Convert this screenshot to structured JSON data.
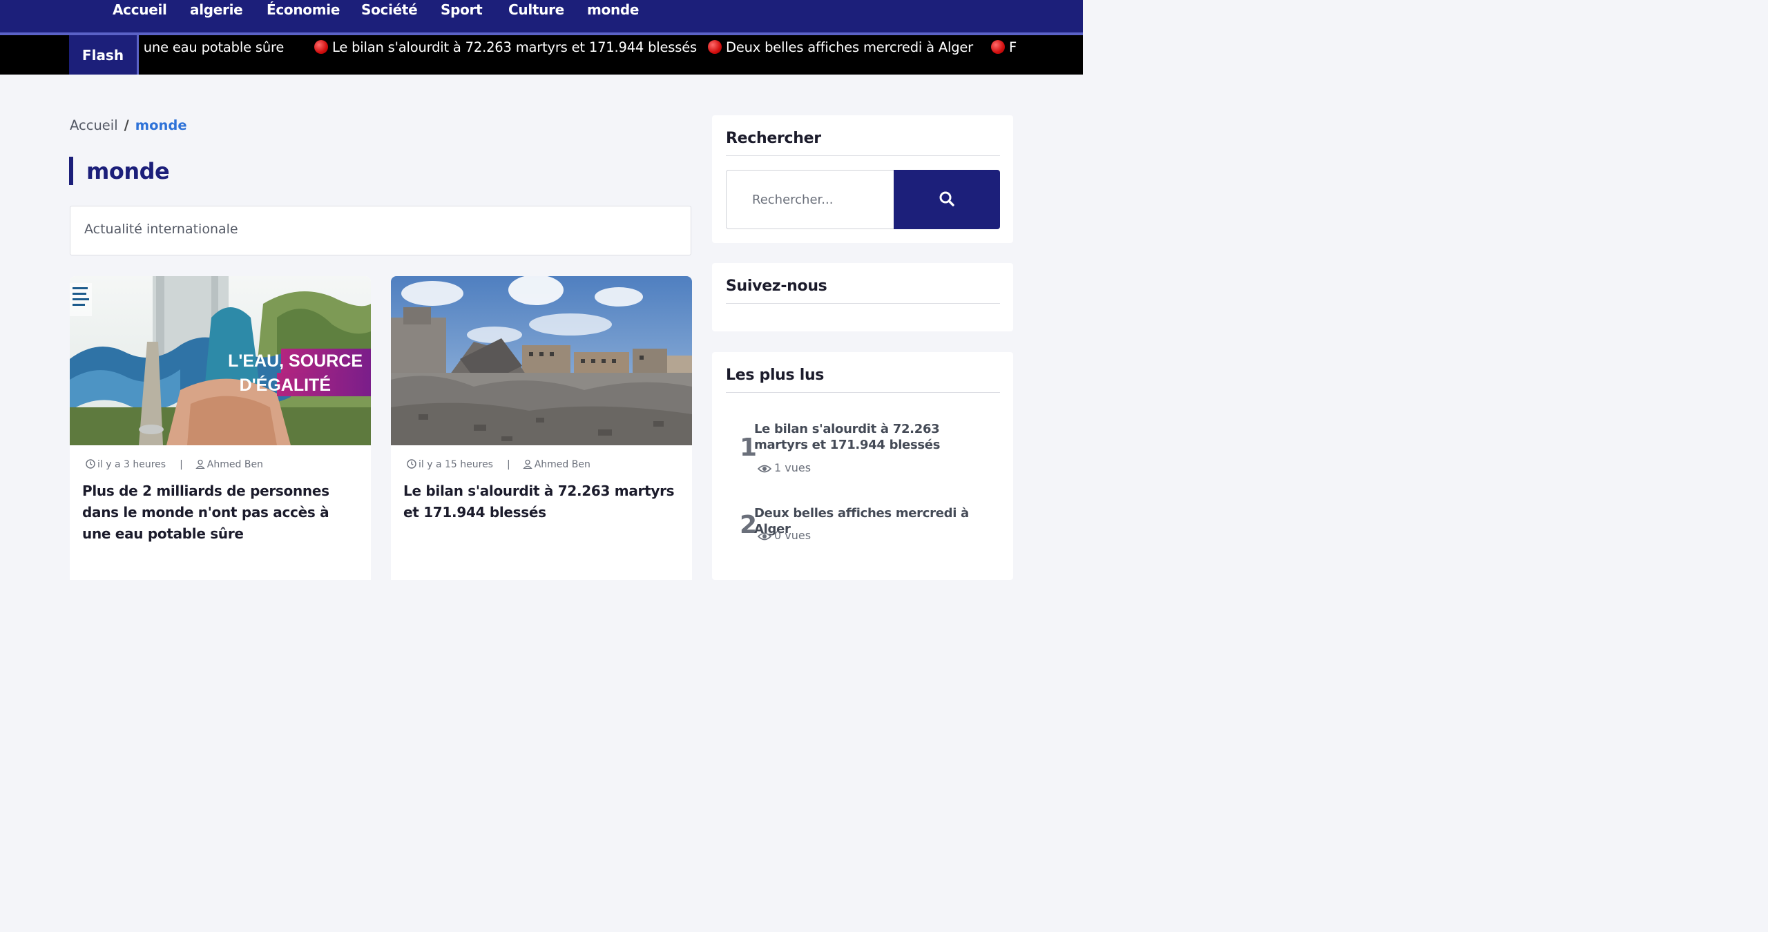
{
  "nav": {
    "items": [
      "Accueil",
      "algerie",
      "Économie",
      "Société",
      "Sport",
      "Culture",
      "monde"
    ]
  },
  "ticker": {
    "badge": "Flash",
    "items": [
      "a une eau potable sûre",
      "Le bilan s'alourdit à 72.263 martyrs et 171.944 blessés",
      "Deux belles affiches mercredi à Alger",
      "F"
    ]
  },
  "breadcrumb": {
    "home": "Accueil",
    "separator": "/",
    "current": "monde"
  },
  "page": {
    "title": "monde",
    "description": "Actualité internationale"
  },
  "articles": [
    {
      "time": "il y a 3 heures",
      "author": "Ahmed Ben",
      "title": "Plus de 2 milliards de personnes dans le monde n'ont pas accès à une eau potable sûre",
      "image_caption_line1": "L'EAU, SOURCE",
      "image_caption_line2": "D'ÉGALITÉ"
    },
    {
      "time": "il y a 15 heures",
      "author": "Ahmed Ben",
      "title": "Le bilan s'alourdit à 72.263 martyrs et 171.944 blessés"
    }
  ],
  "sidebar": {
    "search": {
      "title": "Rechercher",
      "placeholder": "Rechercher..."
    },
    "follow": {
      "title": "Suivez-nous"
    },
    "popular": {
      "title": "Les plus lus",
      "items": [
        {
          "rank": "1",
          "title": "Le bilan s'alourdit à 72.263 martyrs et 171.944 blessés",
          "views": "1 vues"
        },
        {
          "rank": "2",
          "title": "Deux belles affiches mercredi à Alger",
          "views": "0 vues"
        }
      ]
    }
  },
  "colors": {
    "brand_navy": "#1c1f7a",
    "accent_blue": "#2e72d8",
    "ticker_bg": "#000000",
    "page_bg": "#f4f5f9"
  }
}
